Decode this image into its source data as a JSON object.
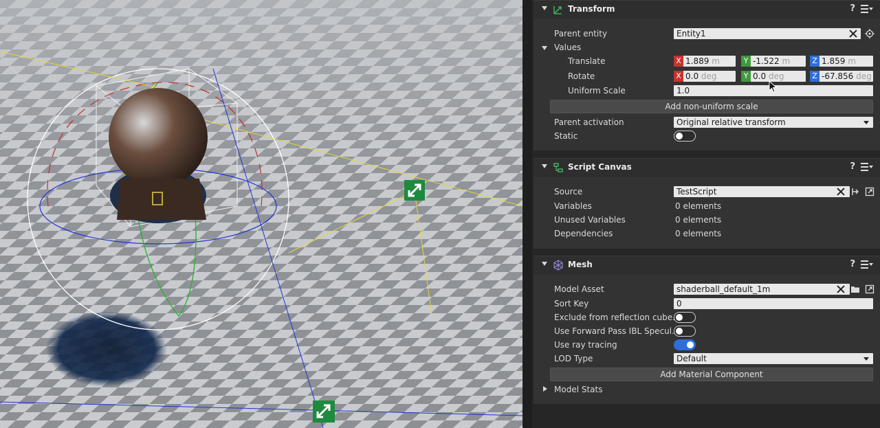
{
  "transform": {
    "title": "Transform",
    "help": "?",
    "icon": "transform-icon",
    "parent_entity_label": "Parent entity",
    "parent_entity_value": "Entity1",
    "values_label": "Values",
    "translate_label": "Translate",
    "translate": {
      "x": "1.889",
      "y": "-1.522",
      "z": "1.859",
      "unit": "m"
    },
    "rotate_label": "Rotate",
    "rotate": {
      "x": "0.0",
      "y": "0.0",
      "z": "-67.856",
      "unit": "deg"
    },
    "uniform_scale_label": "Uniform Scale",
    "uniform_scale_value": "1.0",
    "add_nonuniform_label": "Add non-uniform scale",
    "parent_activation_label": "Parent activation",
    "parent_activation_value": "Original relative transform",
    "static_label": "Static",
    "static_on": false,
    "axis_x": "X",
    "axis_y": "Y",
    "axis_z": "Z"
  },
  "script_canvas": {
    "title": "Script Canvas",
    "help": "?",
    "icon": "script-canvas-icon",
    "source_label": "Source",
    "source_value": "TestScript",
    "variables_label": "Variables",
    "variables_value": "0 elements",
    "unused_label": "Unused Variables",
    "unused_value": "0 elements",
    "dependencies_label": "Dependencies",
    "dependencies_value": "0 elements"
  },
  "mesh": {
    "title": "Mesh",
    "help": "?",
    "icon": "mesh-icon",
    "model_asset_label": "Model Asset",
    "model_asset_value": "shaderball_default_1m",
    "sort_key_label": "Sort Key",
    "sort_key_value": "0",
    "exclude_label": "Exclude from reflection cube...",
    "exclude_on": false,
    "forward_label": "Use Forward Pass IBL Specul...",
    "forward_on": false,
    "raytracing_label": "Use ray tracing",
    "raytracing_on": true,
    "lod_label": "LOD Type",
    "lod_value": "Default",
    "add_material_label": "Add Material Component",
    "model_stats_label": "Model Stats"
  },
  "colors": {
    "axis_x": "#c8322f",
    "axis_y": "#3f9a3c",
    "axis_z": "#2f6ed8",
    "toggle_on": "#2f6ed8",
    "gizmo_green": "#1e8a3e"
  }
}
